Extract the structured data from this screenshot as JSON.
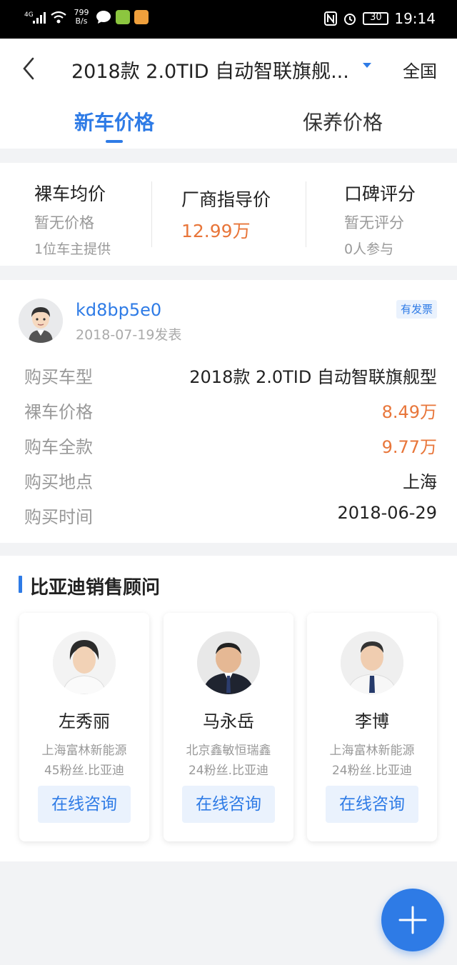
{
  "status_bar": {
    "network": "4G",
    "speed_value": "799",
    "speed_unit": "B/s",
    "battery": "30",
    "time": "19:14"
  },
  "header": {
    "title": "2018款 2.0TID 自动智联旗舰...",
    "region": "全国",
    "tabs": [
      {
        "label": "新车价格",
        "active": true
      },
      {
        "label": "保养价格",
        "active": false
      }
    ]
  },
  "price_summary": {
    "avg_bare": {
      "label": "裸车均价",
      "value": "暂无价格",
      "note": "1位车主提供"
    },
    "msrp": {
      "label": "厂商指导价",
      "value": "12.99万"
    },
    "rating": {
      "label": "口碑评分",
      "value": "暂无评分",
      "note": "0人参与"
    }
  },
  "owner_review": {
    "username": "kd8bp5e0",
    "date": "2018-07-19发表",
    "badge": "有发票",
    "rows": [
      {
        "key": "购买车型",
        "value": "2018款 2.0TID 自动智联旗舰型"
      },
      {
        "key": "裸车价格",
        "value": "8.49万"
      },
      {
        "key": "购车全款",
        "value": "9.77万"
      },
      {
        "key": "购买地点",
        "value": "上海"
      },
      {
        "key": "购买时间",
        "value": "2018-06-29"
      }
    ]
  },
  "advisors": {
    "title": "比亚迪销售顾问",
    "items": [
      {
        "name": "左秀丽",
        "dealer": "上海富林新能源",
        "fans": "45粉丝.比亚迪",
        "button": "在线咨询"
      },
      {
        "name": "马永岳",
        "dealer": "北京鑫敏恒瑞鑫",
        "fans": "24粉丝.比亚迪",
        "button": "在线咨询"
      },
      {
        "name": "李博",
        "dealer": "上海富林新能源",
        "fans": "24粉丝.比亚迪",
        "button": "在线咨询"
      }
    ]
  },
  "colors": {
    "accent": "#2e7be6",
    "price": "#e8763a"
  }
}
